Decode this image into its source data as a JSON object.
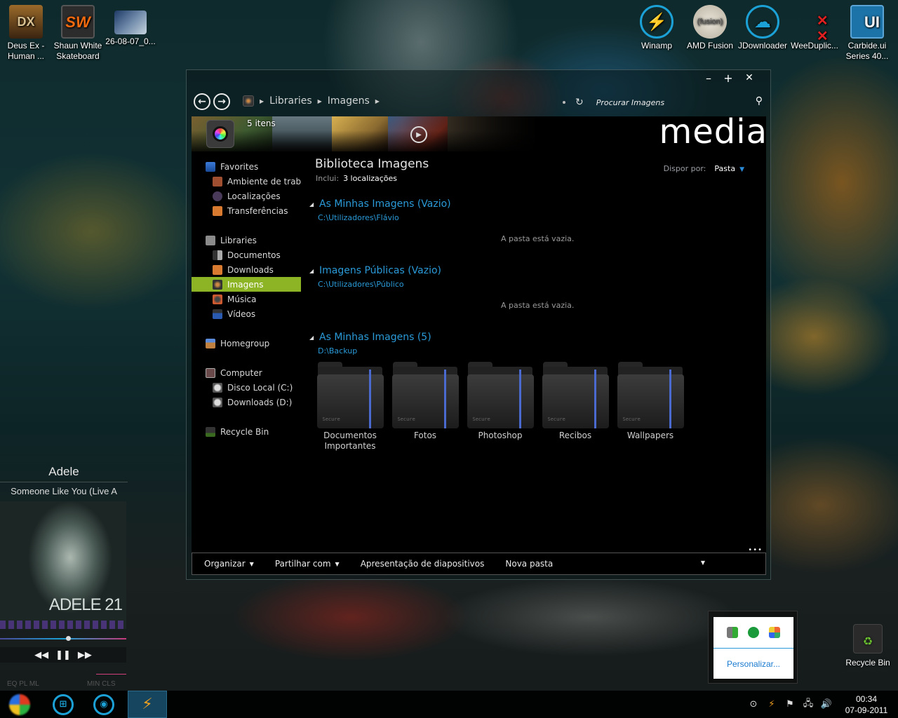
{
  "desktop": {
    "icons_left": [
      {
        "label": "Deus Ex - Human ...",
        "icon": "deus-ex-icon"
      },
      {
        "label": "Shaun White Skateboard",
        "icon": "shaun-white-icon"
      },
      {
        "label": "26-08-07_0...",
        "icon": "image-file-icon"
      }
    ],
    "icons_right": [
      {
        "label": "Winamp",
        "icon": "winamp-icon"
      },
      {
        "label": "AMD Fusion",
        "icon": "amd-fusion-icon"
      },
      {
        "label": "JDownloader",
        "icon": "jdownloader-icon"
      },
      {
        "label": "WeeDuplic...",
        "icon": "weeduplicate-icon"
      },
      {
        "label": "Carbide.ui Series 40...",
        "icon": "carbide-ui-icon"
      }
    ],
    "recycle_bin": {
      "label": "Recycle Bin"
    }
  },
  "explorer": {
    "window_controls": {
      "minimize": "–",
      "maximize": "+",
      "close": "✕"
    },
    "breadcrumb": [
      "Libraries",
      "Imagens"
    ],
    "search": {
      "placeholder": "Procurar Imagens"
    },
    "banner": {
      "items_count": "5 itens",
      "title": "media"
    },
    "nav": {
      "favorites": {
        "label": "Favorites",
        "items": [
          "Ambiente de trabalho",
          "Localizações",
          "Transferências"
        ]
      },
      "libraries": {
        "label": "Libraries",
        "items": [
          "Documentos",
          "Downloads",
          "Imagens",
          "Música",
          "Vídeos"
        ],
        "selected": "Imagens"
      },
      "homegroup": {
        "label": "Homegroup"
      },
      "computer": {
        "label": "Computer",
        "items": [
          "Disco Local (C:)",
          "Downloads (D:)"
        ]
      },
      "recycle_bin": {
        "label": "Recycle Bin"
      }
    },
    "library": {
      "title": "Biblioteca Imagens",
      "includes_label": "Inclui:",
      "includes_value": "3 localizações",
      "arrange_label": "Dispor por:",
      "arrange_value": "Pasta"
    },
    "groups": [
      {
        "title": "As Minhas Imagens (Vazio)",
        "path": "C:\\Utilizadores\\Flávio",
        "empty_note": "A pasta está vazia."
      },
      {
        "title": "Imagens Públicas (Vazio)",
        "path": "C:\\Utilizadores\\Público",
        "empty_note": "A pasta está vazia."
      },
      {
        "title": "As Minhas Imagens (5)",
        "path": "D:\\Backup"
      }
    ],
    "folders": [
      {
        "name": "Documentos Importantes",
        "badge": "Secure"
      },
      {
        "name": "Fotos",
        "badge": "Secure"
      },
      {
        "name": "Photoshop",
        "badge": "Secure"
      },
      {
        "name": "Recibos",
        "badge": "Secure"
      },
      {
        "name": "Wallpapers",
        "badge": "Secure"
      }
    ],
    "commands": {
      "organize": "Organizar",
      "share": "Partilhar com",
      "slideshow": "Apresentação de diapositivos",
      "new_folder": "Nova pasta"
    }
  },
  "winamp_widget": {
    "artist": "Adele",
    "track": "Someone Like You (Live A",
    "album_art_text": "ADELE 21",
    "progress": 0.54,
    "buttons": {
      "eq": "EQ PL ML",
      "minclose": "MIN  CLS"
    }
  },
  "tray_popup": {
    "icons": [
      "usb-safe-remove-icon",
      "utorrent-icon",
      "avg-antivirus-icon"
    ],
    "customize_link": "Personalizar..."
  },
  "taskbar": {
    "pinned": [
      "start-orb",
      "windows-explorer",
      "chrome",
      "winamp"
    ],
    "active": "winamp",
    "clock": {
      "time": "00:34",
      "date": "07-09-2011"
    }
  },
  "colors": {
    "accent_blue": "#2a9ad8",
    "selection_green": "#8cb424",
    "folder_stripe": "#4a6ad0"
  }
}
